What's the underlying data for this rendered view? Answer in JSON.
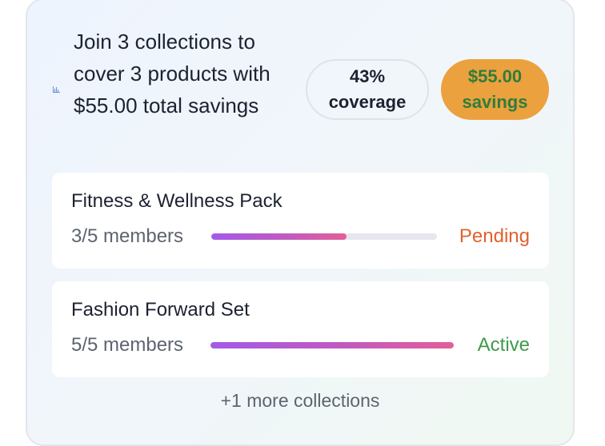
{
  "summary": {
    "headline": "Join 3 collections to cover 3 products with $55.00 total savings",
    "coverage_label": "43%\ncoverage",
    "savings_label": "$55.00\nsavings",
    "icon": "bar-chart-icon"
  },
  "collections": [
    {
      "name": "Fitness & Wellness Pack",
      "members": "3/5 members",
      "progress": 0.6,
      "status": "Pending",
      "status_color": "#e0622d"
    },
    {
      "name": "Fashion Forward Set",
      "members": "5/5 members",
      "progress": 1.0,
      "status": "Active",
      "status_color": "#3e9a4a"
    }
  ],
  "more_label": "+1 more collections",
  "colors": {
    "savings_bg": "#eba13e",
    "savings_text": "#2f7d3b",
    "progress_start": "#a35ae8",
    "progress_end": "#e35e9a"
  }
}
